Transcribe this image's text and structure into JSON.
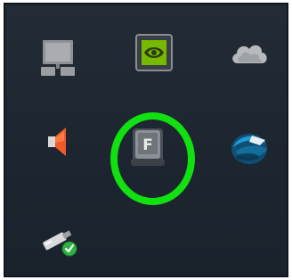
{
  "tray": {
    "background": "#1e2630",
    "icons": [
      {
        "name": "network-icon",
        "kind": "network"
      },
      {
        "name": "nvidia-icon",
        "kind": "nvidia"
      },
      {
        "name": "cloud-icon",
        "kind": "onedrive"
      },
      {
        "name": "volume-icon",
        "kind": "volume-muted"
      },
      {
        "name": "keyboard-icon",
        "kind": "input-language",
        "key_letter": "F"
      },
      {
        "name": "globe-icon",
        "kind": "globe"
      },
      {
        "name": "usb-icon",
        "kind": "safely-remove-hardware"
      }
    ]
  },
  "highlight": {
    "target": "keyboard-icon",
    "color": "#11e011"
  },
  "colors": {
    "nvidia_green": "#76b900",
    "volume_orange": "#f05a28",
    "check_green": "#2fb344",
    "globe_blue": "#1f9bd8"
  }
}
